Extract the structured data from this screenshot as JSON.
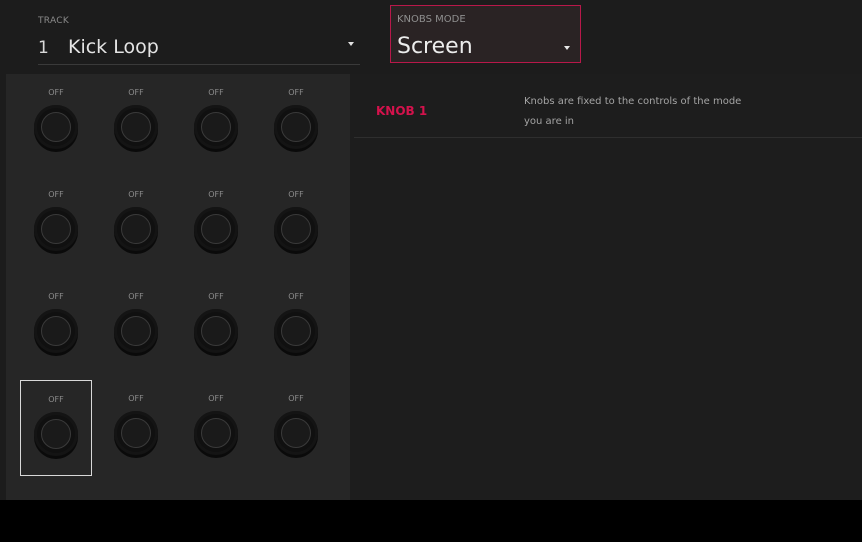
{
  "header": {
    "track": {
      "caption": "TRACK",
      "number": "1",
      "name": "Kick Loop"
    },
    "knobs_mode": {
      "caption": "KNOBS MODE",
      "value": "Screen"
    }
  },
  "knobs": [
    {
      "label": "OFF"
    },
    {
      "label": "OFF"
    },
    {
      "label": "OFF"
    },
    {
      "label": "OFF"
    },
    {
      "label": "OFF"
    },
    {
      "label": "OFF"
    },
    {
      "label": "OFF"
    },
    {
      "label": "OFF"
    },
    {
      "label": "OFF"
    },
    {
      "label": "OFF"
    },
    {
      "label": "OFF"
    },
    {
      "label": "OFF"
    },
    {
      "label": "OFF"
    },
    {
      "label": "OFF"
    },
    {
      "label": "OFF"
    },
    {
      "label": "OFF"
    }
  ],
  "selected_knob_index": 12,
  "info": {
    "knob_name": "KNOB 1",
    "description": "Knobs are fixed to the controls of the mode you are in"
  },
  "colors": {
    "accent": "#d4124c",
    "background": "#1c1c1c",
    "panel": "#262626"
  }
}
